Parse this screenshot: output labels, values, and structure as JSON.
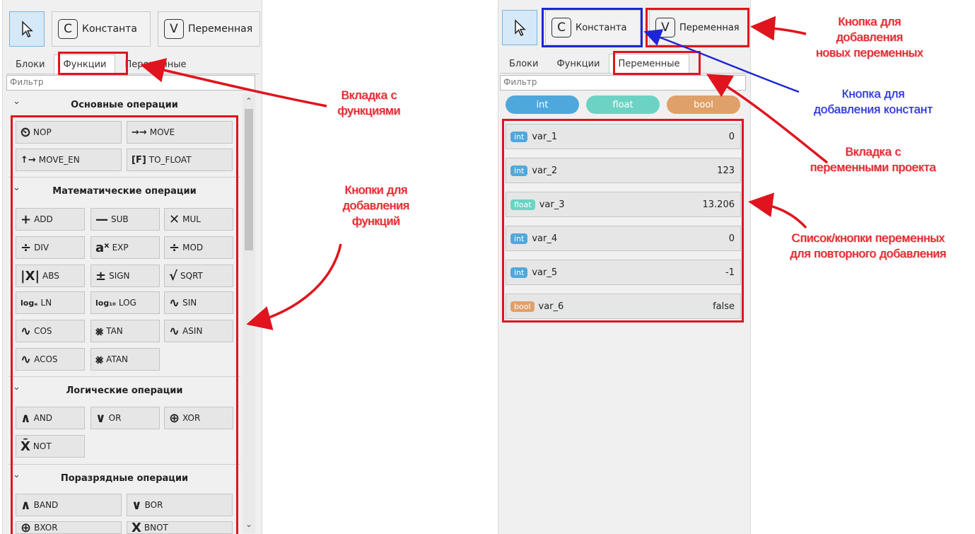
{
  "toolbar": {
    "constant_label": "Константа",
    "constant_letter": "C",
    "variable_label": "Переменная",
    "variable_letter": "V"
  },
  "tabs": [
    "Блоки",
    "Функции",
    "Переменные"
  ],
  "filter_placeholder": "Фильтр",
  "sections": {
    "basic": "Основные операции",
    "math": "Математические операции",
    "logic": "Логические операции",
    "bitwise": "Поразрядные операции"
  },
  "functions": {
    "nop": "NOP",
    "move": "MOVE",
    "move_en": "MOVE_EN",
    "to_float": "TO_FLOAT",
    "add": "ADD",
    "sub": "SUB",
    "mul": "MUL",
    "div": "DIV",
    "exp": "EXP",
    "mod": "MOD",
    "abs": "ABS",
    "sign": "SIGN",
    "sqrt": "SQRT",
    "ln": "LN",
    "log": "LOG",
    "sin": "SIN",
    "cos": "COS",
    "tan": "TAN",
    "asin": "ASIN",
    "acos": "ACOS",
    "atan": "ATAN",
    "and": "AND",
    "or": "OR",
    "xor": "XOR",
    "not": "NOT",
    "band": "BAND",
    "bor": "BOR",
    "bxor": "BXOR",
    "bnot": "BNOT"
  },
  "types": [
    "int",
    "float",
    "bool"
  ],
  "variables": [
    {
      "type": "int",
      "name": "var_1",
      "value": "0"
    },
    {
      "type": "int",
      "name": "var_2",
      "value": "123"
    },
    {
      "type": "float",
      "name": "var_3",
      "value": "13.206"
    },
    {
      "type": "int",
      "name": "var_4",
      "value": "0"
    },
    {
      "type": "int",
      "name": "var_5",
      "value": "-1"
    },
    {
      "type": "bool",
      "name": "var_6",
      "value": "false"
    }
  ],
  "colors": {
    "int": "#4fa8dc",
    "float": "#6cd3c4",
    "bool": "#e0a06a",
    "annotation_red": "#e0141e",
    "annotation_blue": "#1d26d6"
  },
  "annotations": {
    "functions_tab": [
      "Вкладка с",
      "функциями"
    ],
    "function_buttons": [
      "Кнопки для",
      "добавления",
      "функций"
    ],
    "new_variable_button": [
      "Кнопка для",
      "добавления",
      "новых переменных"
    ],
    "constant_button": [
      "Кнопка для",
      "добавления констант"
    ],
    "variables_tab": [
      "Вкладка с",
      "переменными проекта"
    ],
    "variables_list": [
      "Список/кнопки переменных",
      "для повторного добавления"
    ]
  }
}
